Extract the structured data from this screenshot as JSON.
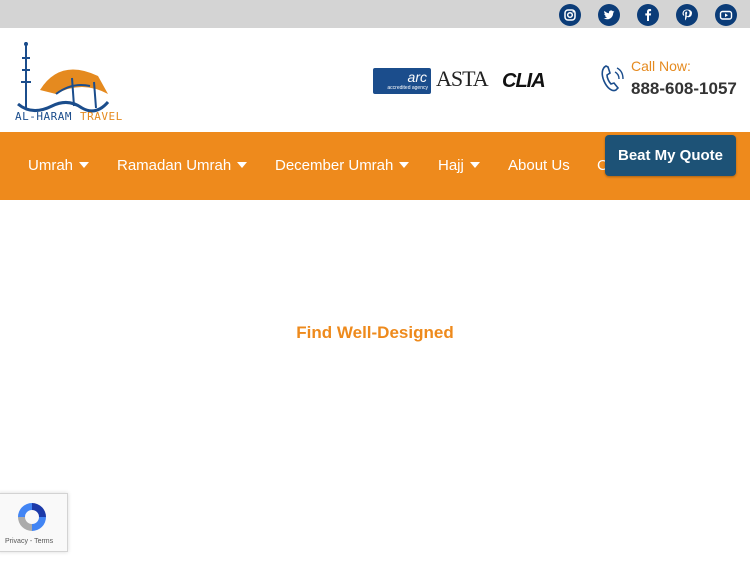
{
  "social": {
    "icons": [
      "instagram-icon",
      "twitter-icon",
      "facebook-icon",
      "pinterest-icon",
      "youtube-icon"
    ],
    "color": "#0b3c78"
  },
  "logo": {
    "part1": "AL-HARAM",
    "part2": "TRAVEL"
  },
  "accreditations": {
    "arc_main": "arc",
    "arc_sub": "accredited agency",
    "asta": "ASTA",
    "clia": "CLIA"
  },
  "contact": {
    "label": "Call Now:",
    "phone": "888-608-1057"
  },
  "nav": {
    "items": [
      {
        "label": "Umrah",
        "dropdown": true
      },
      {
        "label": "Ramadan Umrah",
        "dropdown": true
      },
      {
        "label": "December Umrah",
        "dropdown": true
      },
      {
        "label": "Hajj",
        "dropdown": true
      },
      {
        "label": "About Us",
        "dropdown": false
      },
      {
        "label": "C",
        "dropdown": false
      }
    ],
    "cta": "Beat My Quote",
    "background": "#ee8a1c",
    "cta_color": "#1d5276"
  },
  "main": {
    "headline": "Find Well-Designed"
  },
  "recaptcha": {
    "privacy": "Privacy",
    "separator": " - ",
    "terms": "Terms"
  }
}
